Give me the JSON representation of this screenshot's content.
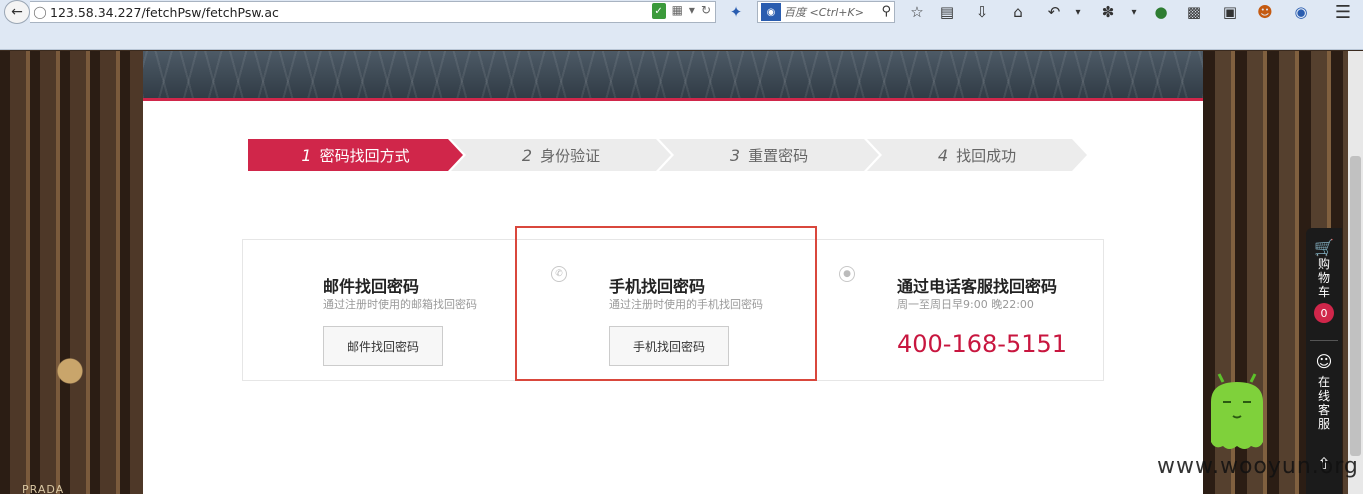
{
  "browser": {
    "url": "123.58.34.227/fetchPsw/fetchPsw.ac",
    "search_placeholder": "百度 <Ctrl+K>"
  },
  "steps": [
    {
      "num": "1",
      "label": "密码找回方式",
      "active": true
    },
    {
      "num": "2",
      "label": "身份验证",
      "active": false
    },
    {
      "num": "3",
      "label": "重置密码",
      "active": false
    },
    {
      "num": "4",
      "label": "找回成功",
      "active": false
    }
  ],
  "options": {
    "email": {
      "title": "邮件找回密码",
      "desc": "通过注册时使用的邮箱找回密码",
      "button": "邮件找回密码"
    },
    "phone": {
      "title": "手机找回密码",
      "desc": "通过注册时使用的手机找回密码",
      "button": "手机找回密码",
      "icon": "phone-icon"
    },
    "service": {
      "title": "通过电话客服找回密码",
      "desc": "周一至周日早9:00 晚22:00",
      "hotline": "400-168-5151",
      "icon": "user-icon"
    }
  },
  "sidebar": {
    "cart_label": "购物车",
    "cart_count": "0",
    "service_label": "在线客服"
  },
  "background_text": "PRADA",
  "watermark": "www.wooyun.org",
  "colors": {
    "accent": "#d0264a",
    "hotline": "#c8163f",
    "highlight_border": "#d9473c"
  }
}
